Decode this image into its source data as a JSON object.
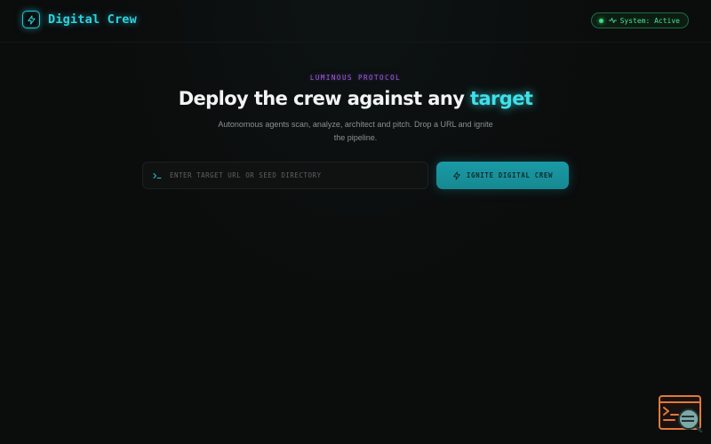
{
  "header": {
    "brand_name": "Digital Crew",
    "logo_icon": "lightning-bolt-icon",
    "status_text": "System: Active",
    "status_color": "#39e07a"
  },
  "hero": {
    "eyebrow": "LUMINOUS PROTOCOL",
    "headline_main": "Deploy the crew against any ",
    "headline_accent": "target",
    "subtitle": "Autonomous agents scan, analyze, architect and pitch. Drop a URL and ignite the pipeline."
  },
  "command": {
    "prompt_icon": "terminal-prompt-icon",
    "placeholder": "ENTER TARGET URL OR SEED DIRECTORY",
    "value": "",
    "button_label": "IGNITE DIGITAL CREW",
    "button_icon": "lightning-bolt-icon"
  },
  "widget": {
    "icon": "terminal-search-icon"
  },
  "colors": {
    "accent_cyan": "#2fd3df",
    "accent_purple": "#a35de8",
    "button_teal": "#1a9aa5",
    "background": "#0b0c0c",
    "widget_orange": "#e07a3a"
  }
}
